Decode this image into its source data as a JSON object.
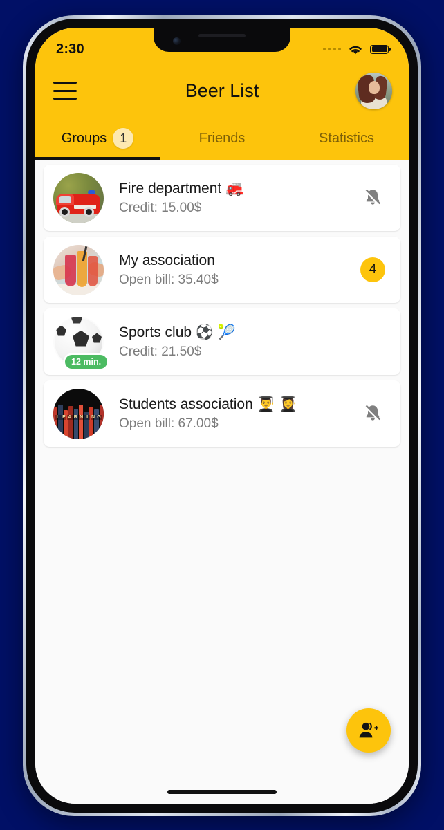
{
  "status_bar": {
    "time": "2:30",
    "signal_icon": "signal-dots-icon",
    "wifi_icon": "wifi-icon",
    "battery_icon": "battery-full-icon"
  },
  "header": {
    "menu_icon": "hamburger-menu-icon",
    "title": "Beer List",
    "avatar_icon": "user-avatar",
    "background_color": "#FDC40C"
  },
  "tabs": [
    {
      "label": "Groups",
      "badge": "1",
      "active": true
    },
    {
      "label": "Friends",
      "badge": null,
      "active": false
    },
    {
      "label": "Statistics",
      "badge": null,
      "active": false
    }
  ],
  "groups": [
    {
      "title": "Fire department 🚒",
      "subtitle": "Credit: 15.00$",
      "avatar_icon": "fire-truck-photo",
      "trailing_type": "bell-off",
      "trailing_value": null,
      "status_pill": null
    },
    {
      "title": "My association",
      "subtitle": "Open bill: 35.40$",
      "avatar_icon": "cocktails-cheers-photo",
      "trailing_type": "count-badge",
      "trailing_value": "4",
      "status_pill": null
    },
    {
      "title": "Sports club ⚽ 🎾",
      "subtitle": "Credit: 21.50$",
      "avatar_icon": "soccer-ball-photo",
      "trailing_type": "none",
      "trailing_value": null,
      "status_pill": "12 min."
    },
    {
      "title": "Students association 👨‍🎓 👩‍🎓",
      "subtitle": "Open bill: 67.00$",
      "avatar_icon": "learning-books-photo",
      "trailing_type": "bell-off",
      "trailing_value": null,
      "status_pill": null
    }
  ],
  "fab": {
    "icon": "person-add-icon",
    "color": "#FDC40C"
  },
  "colors": {
    "accent": "#FDC40C",
    "tab_badge": "#FDE9B0",
    "status_pill": "#4CBB62",
    "page_background": "#011066",
    "list_background": "#FAFAFA",
    "card_background": "#FFFFFF",
    "title_text": "#1A1A1A",
    "subtitle_text": "#7C7C7C",
    "inactive_tab_text": "#7D6008"
  }
}
